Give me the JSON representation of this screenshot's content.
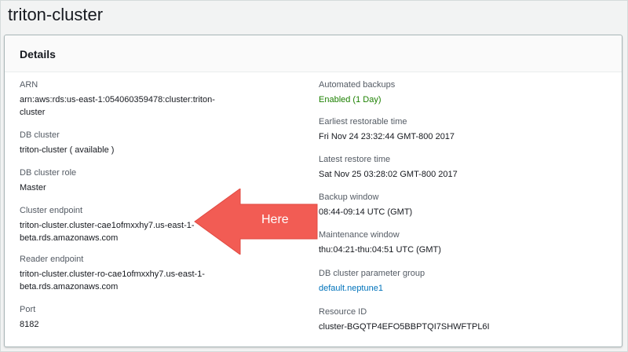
{
  "page": {
    "title": "triton-cluster"
  },
  "panel": {
    "header": "Details"
  },
  "left_fields": [
    {
      "label": "ARN",
      "value": "arn:aws:rds:us-east-1:054060359478:cluster:triton-\ncluster"
    },
    {
      "label": "DB cluster",
      "value": "triton-cluster ( available )"
    },
    {
      "label": "DB cluster role",
      "value": "Master"
    },
    {
      "label": "Cluster endpoint",
      "value": "triton-cluster.cluster-cae1ofmxxhy7.us-east-1-\nbeta.rds.amazonaws.com"
    },
    {
      "label": "Reader endpoint",
      "value": "triton-cluster.cluster-ro-cae1ofmxxhy7.us-east-1-\nbeta.rds.amazonaws.com"
    },
    {
      "label": "Port",
      "value": "8182"
    }
  ],
  "right_fields": [
    {
      "label": "Automated backups",
      "value": "Enabled (1 Day)"
    },
    {
      "label": "Earliest restorable time",
      "value": "Fri Nov 24 23:32:44 GMT-800 2017"
    },
    {
      "label": "Latest restore time",
      "value": "Sat Nov 25 03:28:02 GMT-800 2017"
    },
    {
      "label": "Backup window",
      "value": "08:44-09:14 UTC (GMT)"
    },
    {
      "label": "Maintenance window",
      "value": "thu:04:21-thu:04:51 UTC (GMT)"
    },
    {
      "label": "DB cluster parameter group",
      "value": "default.neptune1"
    },
    {
      "label": "Resource ID",
      "value": "cluster-BGQTP4EFO5BBPTQI7SHWFTPL6I"
    }
  ],
  "annotation": {
    "text": "Here",
    "color": "#f25c54"
  },
  "colors": {
    "status_green": "#1d8102",
    "link_blue": "#0073bb"
  }
}
